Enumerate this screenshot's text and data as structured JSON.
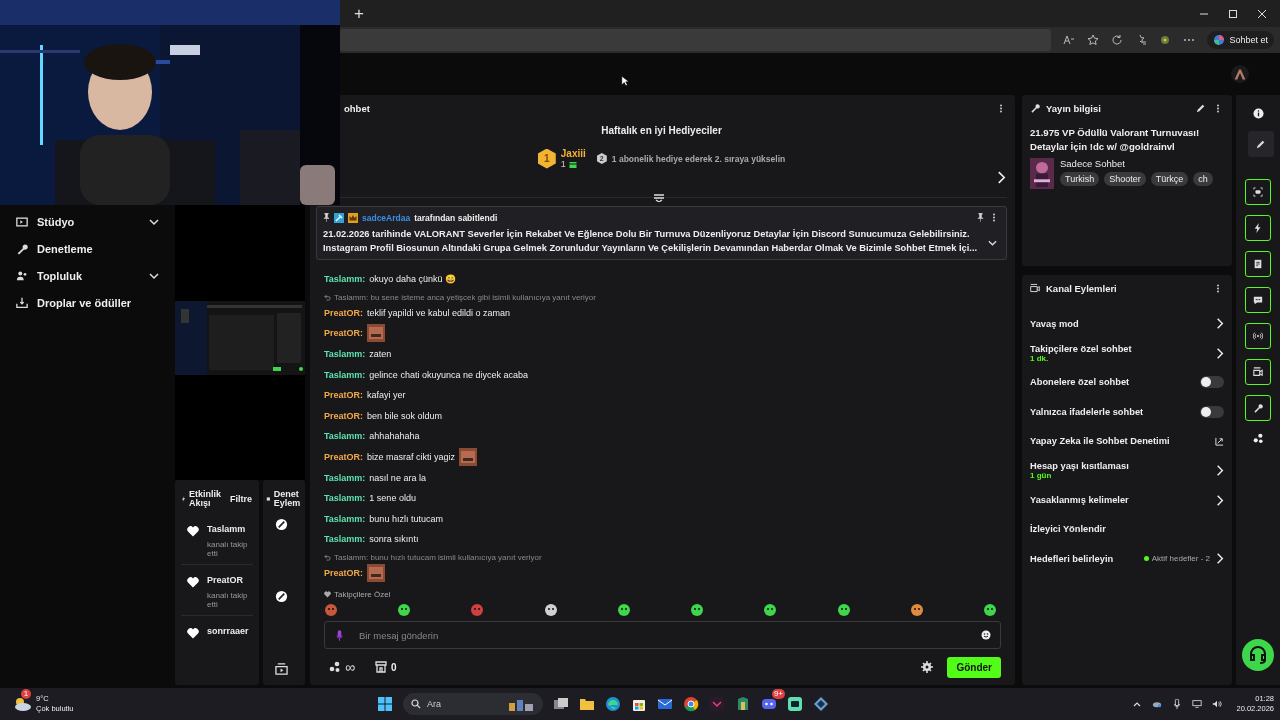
{
  "browser": {
    "new_tab": "+",
    "copilot_button": "Sohbet et"
  },
  "sidebar": {
    "items": [
      {
        "label": "Stüdyo",
        "expandable": true
      },
      {
        "label": "Denetleme",
        "expandable": false
      },
      {
        "label": "Topluluk",
        "expandable": true
      },
      {
        "label": "Droplar ve ödüller",
        "expandable": false
      }
    ]
  },
  "activity_panel": {
    "title": "Etkinlik Akışı",
    "filter": "Filtre",
    "events": [
      {
        "user": "Taslamm",
        "text": "kanalı takip etti"
      },
      {
        "user": "PreatOR",
        "text": "kanalı takip etti"
      },
      {
        "user": "sonrraaer"
      }
    ]
  },
  "mod_panel": {
    "title": "Denet Eylem"
  },
  "chat": {
    "title": "ohbet",
    "top_gifters": {
      "title": "Haftalık en iyi Hediyeciler",
      "rank": "1",
      "user": "Jaxiii",
      "count": "1",
      "next_rank": "2",
      "hint": "1 abonelik hediye ederek 2. sıraya yükselin"
    },
    "pinned": {
      "user": "sadceArdaa",
      "label": "tarafından sabitlendi",
      "text": "21.02.2026 tarihinde VALORANT Severler İçin Rekabet Ve Eğlence Dolu Bir Turnuva Düzenliyoruz Detaylar İçin Discord Sunucumuza Gelebilirsiniz. Instagram Profil Biosunun Altındaki Grupa Gelmek Zorunludur Yayınların Ve Çekilişlerin Devamından Haberdar Olmak Ve Bizimle Sohbet Etmek İçi..."
    },
    "messages": [
      {
        "kind": "message",
        "user": "Taslamm:",
        "color": "#5fe3b0",
        "text": "okuyo daha çünkü 😄",
        "emote": false
      },
      {
        "kind": "reply",
        "text": "Taslamm: bu sene isteme anca yetişcek gibi isimli kullanıcıya yanıt veriyor"
      },
      {
        "kind": "message",
        "user": "PreatOR:",
        "color": "#f2a94a",
        "text": "teklif yapildi ve kabul edildi o zaman",
        "emote": false
      },
      {
        "kind": "message",
        "user": "PreatOR:",
        "color": "#f2a94a",
        "emote": true
      },
      {
        "kind": "message",
        "user": "Taslamm:",
        "color": "#5fe3b0",
        "text": "zaten",
        "emote": false
      },
      {
        "kind": "message",
        "user": "Taslamm:",
        "color": "#5fe3b0",
        "text": "gelince chati okuyunca ne diycek acaba",
        "emote": false
      },
      {
        "kind": "message",
        "user": "PreatOR:",
        "color": "#f2a94a",
        "text": "kafayi yer",
        "emote": false
      },
      {
        "kind": "message",
        "user": "PreatOR:",
        "color": "#f2a94a",
        "text": "ben bile sok oldum",
        "emote": false
      },
      {
        "kind": "message",
        "user": "Taslamm:",
        "color": "#5fe3b0",
        "text": "ahhahahaha",
        "emote": false
      },
      {
        "kind": "message",
        "user": "PreatOR:",
        "color": "#f2a94a",
        "text": "bize masraf cikti yagiz",
        "emote": true
      },
      {
        "kind": "message",
        "user": "Taslamm:",
        "color": "#5fe3b0",
        "text": "nasıl ne ara la",
        "emote": false
      },
      {
        "kind": "message",
        "user": "Taslamm:",
        "color": "#5fe3b0",
        "text": "1 sene oldu",
        "emote": false
      },
      {
        "kind": "message",
        "user": "Taslamm:",
        "color": "#5fe3b0",
        "text": "bunu hızlı tutucam",
        "emote": false
      },
      {
        "kind": "message",
        "user": "Taslamm:",
        "color": "#5fe3b0",
        "text": "sonra sıkıntı",
        "emote": false
      },
      {
        "kind": "reply",
        "text": "Taslamm: bunu hızlı tutucam isimli kullanıcıya yanıt veriyor"
      },
      {
        "kind": "message",
        "user": "PreatOR:",
        "color": "#f2a94a",
        "emote": true
      }
    ],
    "emote_label": "Takipçilere Özel",
    "input": {
      "placeholder": "Bir mesaj gönderin"
    },
    "infinity": "∞",
    "points": "0",
    "send": "Gönder"
  },
  "stream_info": {
    "title": "Yayın bilgisi",
    "stream_title": "21.975 VP Ödüllü Valorant Turnuvası! Detaylar İçin !dc w/ @goldrainvl",
    "category": "Sadece Sohbet",
    "tags": [
      "Turkish",
      "Shooter",
      "Türkçe",
      "ch"
    ]
  },
  "channel_actions": {
    "title": "Kanal Eylemleri",
    "items": [
      {
        "kind": "link",
        "label": "Yavaş mod"
      },
      {
        "kind": "link",
        "label": "Takipçilere özel sohbet",
        "value": "1 dk."
      },
      {
        "kind": "toggle",
        "label": "Abonelere özel sohbet",
        "on": false
      },
      {
        "kind": "toggle",
        "label": "Yalnızca ifadelerle sohbet",
        "on": false
      },
      {
        "kind": "external",
        "label": "Yapay Zeka ile Sohbet Denetimi"
      },
      {
        "kind": "link",
        "label": "Hesap yaşı kısıtlaması",
        "value": "1 gün"
      },
      {
        "kind": "link",
        "label": "Yasaklanmış kelimeler"
      },
      {
        "kind": "plain",
        "label": "İzleyici Yönlendir"
      },
      {
        "kind": "link",
        "label": "Hedefleri belirleyin",
        "status": "Aktif hedefler - 2"
      }
    ]
  },
  "taskbar": {
    "temperature": "9°C",
    "weather": "Çok bulutlu",
    "weather_badge": "1",
    "search": "Ara",
    "discord_badge": "9+",
    "time": "01:28",
    "date": "20.02.2026"
  }
}
